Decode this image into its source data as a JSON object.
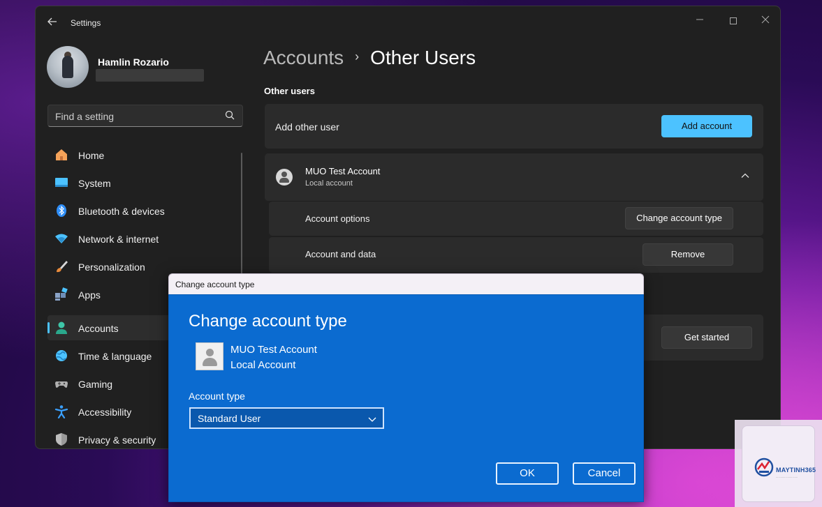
{
  "window": {
    "title": "Settings",
    "controls": [
      "minimize",
      "maximize",
      "close"
    ]
  },
  "profile": {
    "name": "Hamlin Rozario"
  },
  "search": {
    "placeholder": "Find a setting"
  },
  "sidebar": {
    "items": [
      {
        "label": "Home",
        "icon": "home-icon",
        "color": "#f4a259"
      },
      {
        "label": "System",
        "icon": "system-icon",
        "color": "#4cc2ff"
      },
      {
        "label": "Bluetooth & devices",
        "icon": "bluetooth-icon",
        "color": "#2f8ef7"
      },
      {
        "label": "Network & internet",
        "icon": "wifi-icon",
        "color": "#4cc2ff"
      },
      {
        "label": "Personalization",
        "icon": "brush-icon",
        "color": "#e88b3c"
      },
      {
        "label": "Apps",
        "icon": "apps-icon",
        "color": "#6f8fb8"
      },
      {
        "label": "Accounts",
        "icon": "person-icon",
        "color": "#3ec6a8",
        "active": true
      },
      {
        "label": "Time & language",
        "icon": "globe-icon",
        "color": "#4cc2ff"
      },
      {
        "label": "Gaming",
        "icon": "gamepad-icon",
        "color": "#b0b0b0"
      },
      {
        "label": "Accessibility",
        "icon": "accessibility-icon",
        "color": "#3aa0ff"
      },
      {
        "label": "Privacy & security",
        "icon": "shield-icon",
        "color": "#9a9a9a"
      }
    ]
  },
  "breadcrumb": {
    "parent": "Accounts",
    "separator": "›",
    "current": "Other Users"
  },
  "main": {
    "section_title": "Other users",
    "add_user": {
      "label": "Add other user",
      "button": "Add account"
    },
    "user_card": {
      "name": "MUO Test Account",
      "type": "Local account",
      "expanded": true,
      "rows": [
        {
          "label": "Account options",
          "button": "Change account type"
        },
        {
          "label": "Account and data",
          "button": "Remove"
        }
      ]
    },
    "kiosk": {
      "button": "Get started"
    }
  },
  "dialog": {
    "title": "Change account type",
    "heading": "Change account type",
    "account_name": "MUO Test Account",
    "account_kind": "Local Account",
    "type_label": "Account type",
    "selected_type": "Standard User",
    "ok": "OK",
    "cancel": "Cancel"
  },
  "watermark": {
    "brand": "MAYTINH365"
  },
  "colors": {
    "accent": "#4cc2ff",
    "dialog_blue": "#0b6bd0",
    "window_bg": "#202020",
    "card_bg": "#2b2b2b"
  }
}
